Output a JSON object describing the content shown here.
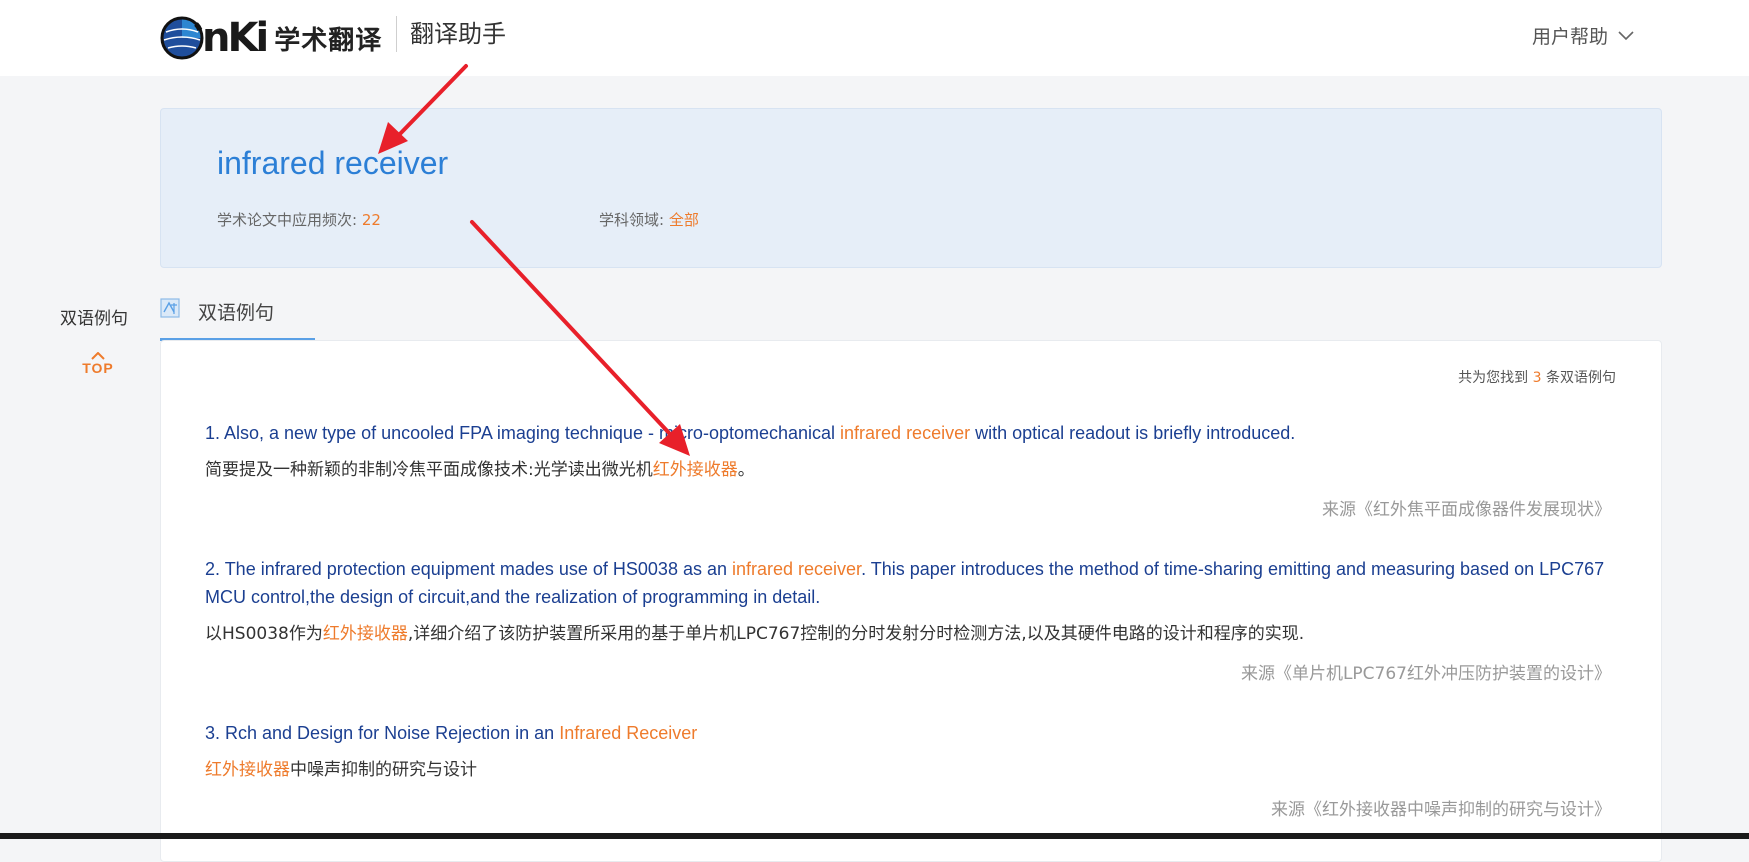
{
  "header": {
    "logo_letters": "nKi",
    "logo_cn": "学术翻译",
    "product": "翻译助手",
    "help_label": "用户帮助"
  },
  "term": {
    "title": "infrared receiver",
    "freq_label": "学术论文中应用频次:",
    "freq_value": "22",
    "field_label": "学科领域:",
    "field_value": "全部"
  },
  "sidebar": {
    "section_label": "双语例句",
    "top_label": "TOP"
  },
  "tab": {
    "label": "双语例句"
  },
  "results": {
    "count_prefix": "共为您找到",
    "count_value": "3",
    "count_suffix": "条双语例句"
  },
  "examples": [
    {
      "en_pre": "1. Also, a new type of uncooled FPA imaging technique - micro-optomechanical ",
      "en_hl": "infrared receiver",
      "en_post": " with optical readout is briefly introduced.",
      "zh_pre": "简要提及一种新颖的非制冷焦平面成像技术:光学读出微光机",
      "zh_hl": "红外接收器",
      "zh_post": "。",
      "source": "来源《红外焦平面成像器件发展现状》"
    },
    {
      "en_pre": "2. The infrared protection equipment mades use of HS0038 as an ",
      "en_hl": "infrared receiver",
      "en_post": ". This paper introduces the method of time-sharing emitting and measuring based on LPC767 MCU control,the design of circuit,and the realization of programming in detail.",
      "zh_pre": "以HS0038作为",
      "zh_hl": "红外接收器",
      "zh_post": ",详细介绍了该防护装置所采用的基于单片机LPC767控制的分时发射分时检测方法,以及其硬件电路的设计和程序的实现.",
      "source": "来源《单片机LPC767红外冲压防护装置的设计》"
    },
    {
      "en_pre": "3. Rch and Design for Noise Rejection in an ",
      "en_hl": "Infrared Receiver",
      "en_post": "",
      "zh_pre": "",
      "zh_hl": "红外接收器",
      "zh_post": "中噪声抑制的研究与设计",
      "source": "来源《红外接收器中噪声抑制的研究与设计》"
    }
  ],
  "colors": {
    "accent_orange": "#ee7b2c",
    "title_blue": "#2c7fd6",
    "english_blue": "#1b3f91",
    "annotation_red": "#e8202a"
  }
}
